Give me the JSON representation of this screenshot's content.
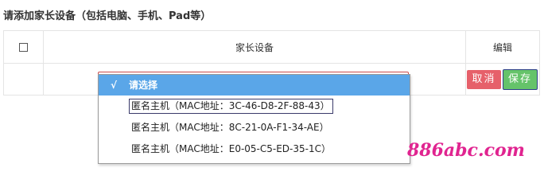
{
  "heading": "请添加家长设备（包括电脑、手机、Pad等）",
  "table": {
    "columns": [
      "",
      "家长设备",
      "编辑"
    ]
  },
  "dropdown": {
    "check_mark": "√",
    "selected_label": "请选择",
    "options": [
      "匿名主机（MAC地址：3C-46-D8-2F-88-43）",
      "匿名主机（MAC地址：8C-21-0A-F1-34-AE）",
      "匿名主机（MAC地址：E0-05-C5-ED-35-1C）"
    ]
  },
  "buttons": {
    "cancel": "取消",
    "save": "保存"
  },
  "watermark": "886abc.com",
  "colors": {
    "selected_bg": "#5aa6e8",
    "cancel_bg": "#e6606a",
    "save_bg": "#65c36a",
    "watermark": "#e02490"
  }
}
